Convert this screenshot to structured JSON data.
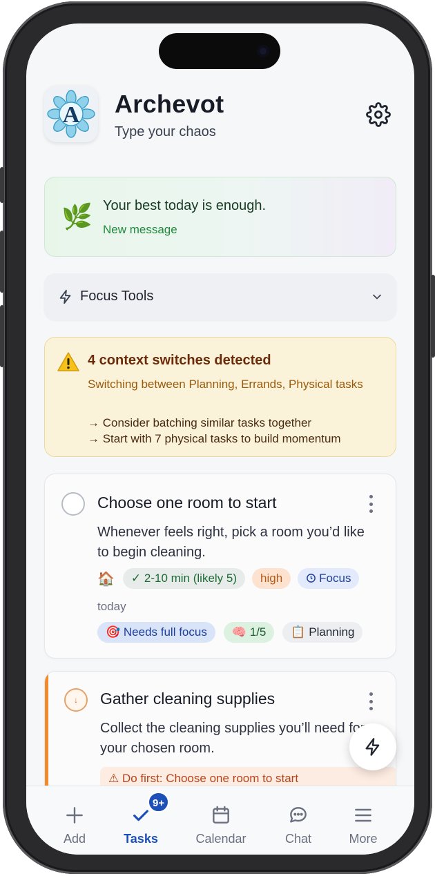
{
  "app": {
    "title": "Archevot",
    "subtitle": "Type your chaos",
    "logo_letter": "A",
    "settings_icon": "gear-icon"
  },
  "motivation": {
    "message": "Your best today is enough.",
    "status": "New message",
    "icon": "leaf-icon"
  },
  "focus_tools": {
    "label": "Focus Tools",
    "icon": "bolt-icon"
  },
  "warning": {
    "title": "4 context switches detected",
    "subtitle": "Switching between Planning, Errands, Physical tasks",
    "tips": [
      "→ Consider batching similar tasks together",
      "→ Start with 7 physical tasks to build momentum"
    ]
  },
  "tasks": [
    {
      "title": "Choose one room to start",
      "description": "Whenever feels right, pick a room you’d like to begin cleaning.",
      "category_icon": "🏠",
      "time": "✓ 2-10 min (likely 5)",
      "priority": "high",
      "mode": "Focus",
      "due": "today",
      "focus_need": "🎯 Needs full focus",
      "energy": "🧠 1/5",
      "tag": "📋 Planning"
    },
    {
      "title": "Gather cleaning supplies",
      "description": "Collect the cleaning supplies you’ll need for your chosen room.",
      "dependency": "⚠ Do first: Choose one room to start"
    }
  ],
  "nav": {
    "items": [
      {
        "label": "Add",
        "icon": "plus-icon"
      },
      {
        "label": "Tasks",
        "icon": "check-icon",
        "badge": "9+"
      },
      {
        "label": "Calendar",
        "icon": "calendar-icon"
      },
      {
        "label": "Chat",
        "icon": "chat-icon"
      },
      {
        "label": "More",
        "icon": "menu-icon"
      }
    ],
    "active": "Tasks"
  },
  "colors": {
    "accent": "#1d4fb8",
    "warning_bg": "#fbf3d9",
    "success_text": "#1f8a3b",
    "priority_orange": "#f08a2c"
  }
}
